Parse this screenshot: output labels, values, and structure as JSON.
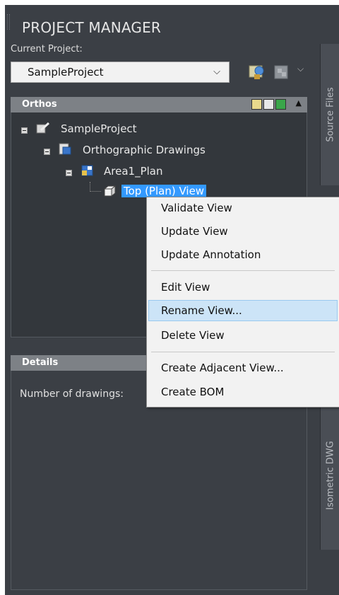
{
  "panel": {
    "title": "PROJECT MANAGER",
    "current_project_label": "Current Project:",
    "current_project_value": "SampleProject",
    "side_tabs": [
      "Source Files",
      "Isometric DWG"
    ]
  },
  "orthos": {
    "header": "Orthos",
    "tree": {
      "root": "SampleProject",
      "group": "Orthographic Drawings",
      "drawing": "Area1_Plan",
      "view": "Top (Plan) View"
    }
  },
  "details": {
    "header": "Details",
    "number_of_drawings_label": "Number of drawings:"
  },
  "context_menu": {
    "items": [
      "Validate View",
      "Update View",
      "Update Annotation",
      "Edit View",
      "Rename View...",
      "Delete View",
      "Create Adjacent View...",
      "Create BOM"
    ],
    "highlighted": "Rename View..."
  },
  "colors": {
    "panel_bg": "#3b3f45",
    "header_bg": "#7d8186",
    "selection": "#3399ff",
    "menu_highlight": "#cce4f7"
  }
}
